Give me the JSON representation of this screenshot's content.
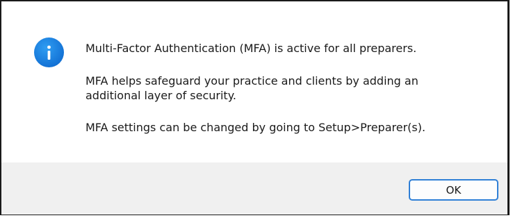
{
  "dialog": {
    "icon": "info-icon",
    "message_line1": "Multi-Factor Authentication (MFA) is active for all preparers.",
    "message_line2a": "MFA helps safeguard your practice and clients by adding an",
    "message_line2b": "additional layer of security.",
    "message_line3": "MFA settings can be changed by going to Setup>Preparer(s).",
    "ok_label": "OK",
    "accent_color": "#1473d6"
  }
}
